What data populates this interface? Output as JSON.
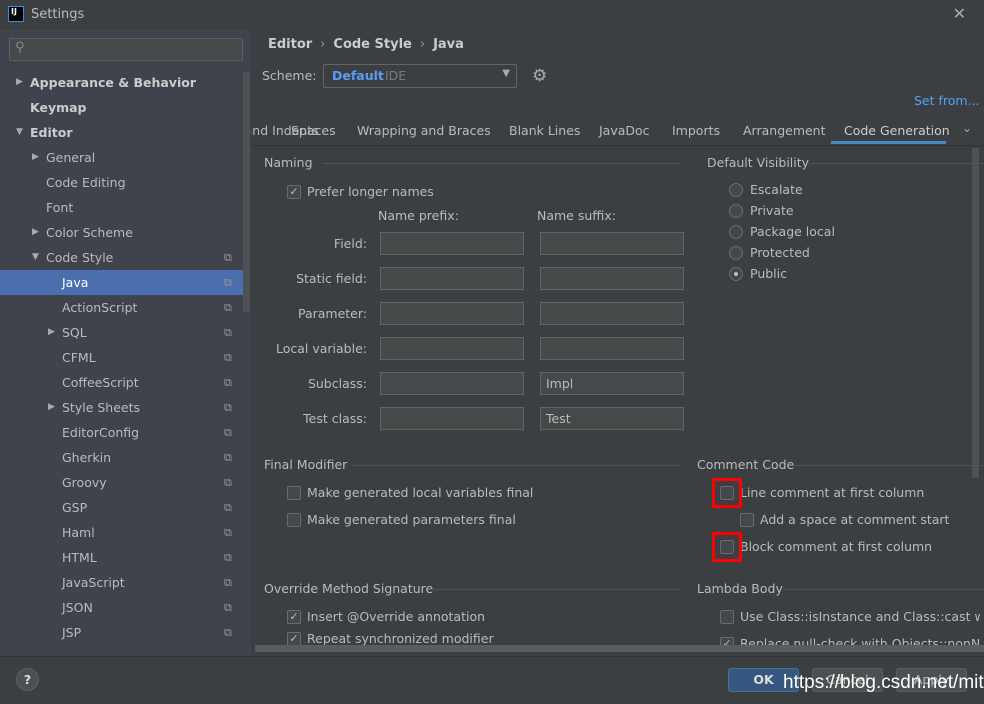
{
  "window": {
    "title": "Settings",
    "app_icon": "IJ"
  },
  "sidebar": {
    "search_placeholder": "",
    "items": [
      {
        "label": "Appearance & Behavior",
        "level": 0,
        "arrow": "▶",
        "bold": true
      },
      {
        "label": "Keymap",
        "level": 0,
        "arrow": "",
        "bold": true
      },
      {
        "label": "Editor",
        "level": 0,
        "arrow": "▼",
        "bold": true
      },
      {
        "label": "General",
        "level": 1,
        "arrow": "▶"
      },
      {
        "label": "Code Editing",
        "level": 1,
        "arrow": ""
      },
      {
        "label": "Font",
        "level": 1,
        "arrow": ""
      },
      {
        "label": "Color Scheme",
        "level": 1,
        "arrow": "▶"
      },
      {
        "label": "Code Style",
        "level": 1,
        "arrow": "▼",
        "copy": true
      },
      {
        "label": "Java",
        "level": 2,
        "arrow": "",
        "copy": true,
        "selected": true
      },
      {
        "label": "ActionScript",
        "level": 2,
        "arrow": "",
        "copy": true
      },
      {
        "label": "SQL",
        "level": 2,
        "arrow": "▶",
        "copy": true
      },
      {
        "label": "CFML",
        "level": 2,
        "arrow": "",
        "copy": true
      },
      {
        "label": "CoffeeScript",
        "level": 2,
        "arrow": "",
        "copy": true
      },
      {
        "label": "Style Sheets",
        "level": 2,
        "arrow": "▶",
        "copy": true
      },
      {
        "label": "EditorConfig",
        "level": 2,
        "arrow": "",
        "copy": true
      },
      {
        "label": "Gherkin",
        "level": 2,
        "arrow": "",
        "copy": true
      },
      {
        "label": "Groovy",
        "level": 2,
        "arrow": "",
        "copy": true
      },
      {
        "label": "GSP",
        "level": 2,
        "arrow": "",
        "copy": true
      },
      {
        "label": "Haml",
        "level": 2,
        "arrow": "",
        "copy": true
      },
      {
        "label": "HTML",
        "level": 2,
        "arrow": "",
        "copy": true
      },
      {
        "label": "JavaScript",
        "level": 2,
        "arrow": "",
        "copy": true
      },
      {
        "label": "JSON",
        "level": 2,
        "arrow": "",
        "copy": true
      },
      {
        "label": "JSP",
        "level": 2,
        "arrow": "",
        "copy": true
      }
    ]
  },
  "breadcrumb": [
    "Editor",
    "Code Style",
    "Java"
  ],
  "scheme": {
    "label": "Scheme:",
    "name": "Default",
    "type": "IDE"
  },
  "set_from": "Set from...",
  "tabs": [
    "Tabs and Indents",
    "Spaces",
    "Wrapping and Braces",
    "Blank Lines",
    "JavaDoc",
    "Imports",
    "Arrangement",
    "Code Generation"
  ],
  "active_tab": "Code Generation",
  "naming": {
    "title": "Naming",
    "prefer_longer": {
      "label": "Prefer longer names",
      "checked": true
    },
    "prefix_header": "Name prefix:",
    "suffix_header": "Name suffix:",
    "rows": [
      {
        "label": "Field:",
        "prefix": "",
        "suffix": ""
      },
      {
        "label": "Static field:",
        "prefix": "",
        "suffix": ""
      },
      {
        "label": "Parameter:",
        "prefix": "",
        "suffix": ""
      },
      {
        "label": "Local variable:",
        "prefix": "",
        "suffix": ""
      },
      {
        "label": "Subclass:",
        "prefix": "",
        "suffix": "Impl"
      },
      {
        "label": "Test class:",
        "prefix": "",
        "suffix": "Test"
      }
    ]
  },
  "visibility": {
    "title": "Default Visibility",
    "options": [
      "Escalate",
      "Private",
      "Package local",
      "Protected",
      "Public"
    ],
    "selected": "Public"
  },
  "final_modifier": {
    "title": "Final Modifier",
    "items": [
      {
        "label": "Make generated local variables final",
        "checked": false
      },
      {
        "label": "Make generated parameters final",
        "checked": false
      }
    ]
  },
  "comment_code": {
    "title": "Comment Code",
    "items": [
      {
        "label": "Line comment at first column",
        "checked": false,
        "highlighted": true
      },
      {
        "label": "Add a space at comment start",
        "checked": false
      },
      {
        "label": "Block comment at first column",
        "checked": false,
        "highlighted": true
      }
    ]
  },
  "override": {
    "title": "Override Method Signature",
    "items": [
      {
        "label": "Insert @Override annotation",
        "checked": true
      },
      {
        "label": "Repeat synchronized modifier",
        "checked": true
      }
    ]
  },
  "lambda": {
    "title": "Lambda Body",
    "items": [
      {
        "label": "Use Class::isInstance and Class::cast when possible",
        "checked": false
      },
      {
        "label": "Replace null-check with Objects::nonNull or Objects::isNull",
        "checked": true
      }
    ]
  },
  "footer": {
    "help": "?",
    "ok": "OK",
    "cancel": "Cancel",
    "apply": "Apply"
  },
  "watermark": "https://blog.csdn.net/mitays",
  "colors": {
    "accent": "#4b6eaf",
    "link": "#589df6",
    "highlight": "#ff0000"
  }
}
